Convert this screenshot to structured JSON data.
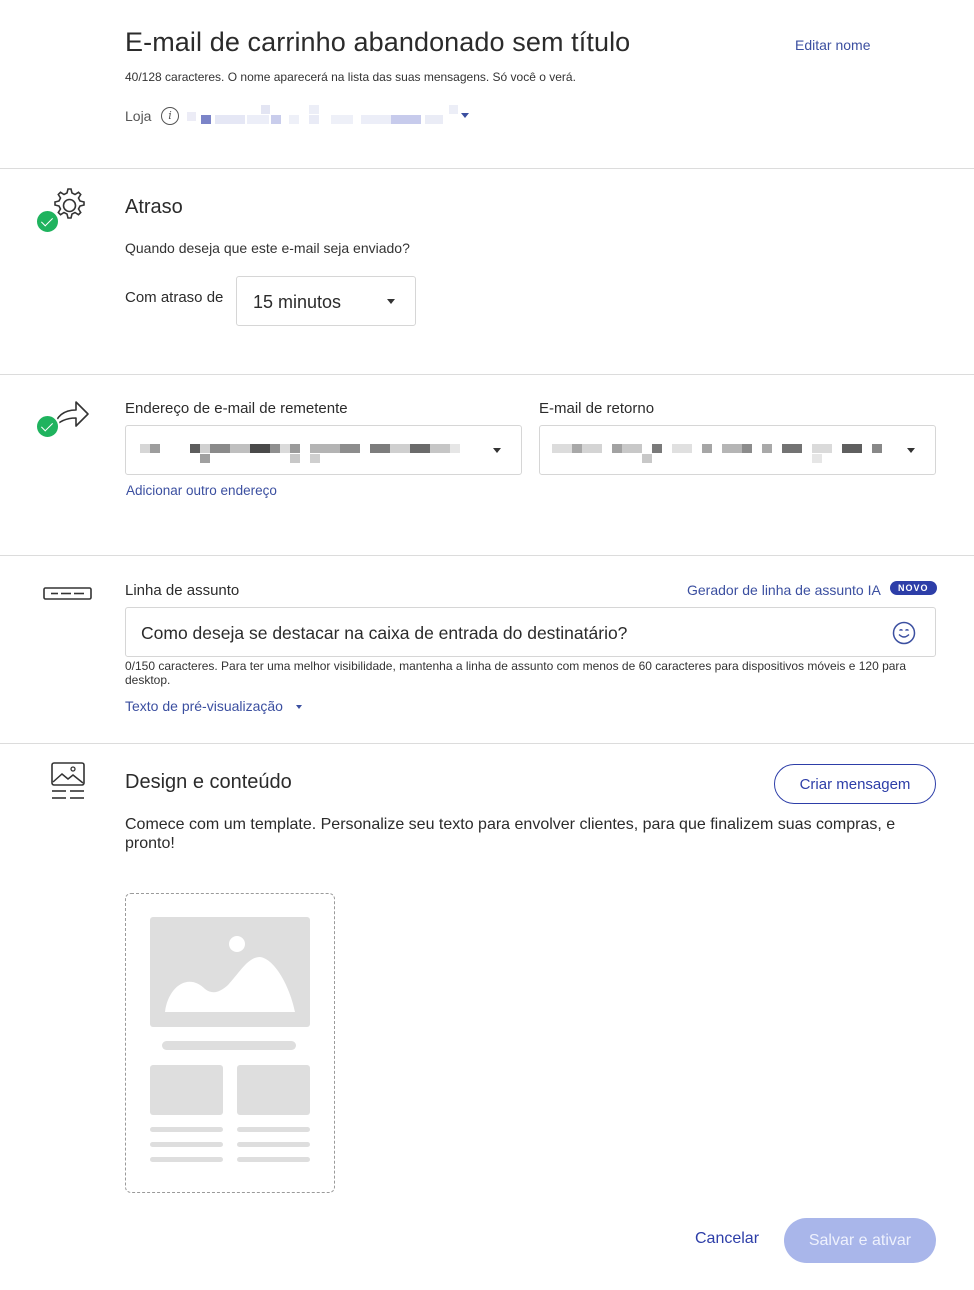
{
  "header": {
    "title": "E-mail de carrinho abandonado sem título",
    "edit_name": "Editar nome",
    "hint": "40/128 caracteres. O nome aparecerá na lista das suas mensagens. Só você o verá.",
    "store_label": "Loja",
    "info_glyph": "i"
  },
  "delay": {
    "title": "Atraso",
    "question": "Quando deseja que este e-mail seja enviado?",
    "label": "Com atraso de",
    "selected": "15 minutos"
  },
  "sender": {
    "from_label": "Endereço de e-mail de remetente",
    "reply_label": "E-mail de retorno",
    "add_address": "Adicionar outro endereço"
  },
  "subject": {
    "label": "Linha de assunto",
    "ai_link": "Gerador de linha de assunto IA",
    "badge": "NOVO",
    "placeholder": "Como deseja se destacar na caixa de entrada do destinatário?",
    "counter": "0/150 caracteres. Para ter uma melhor visibilidade, mantenha a linha de assunto com menos de 60 caracteres para dispositivos móveis e 120 para desktop.",
    "preview_link": "Texto de pré-visualização"
  },
  "design": {
    "title": "Design e conteúdo",
    "create_button": "Criar mensagem",
    "description": "Comece com um template. Personalize seu texto para envolver clientes, para que finalizem suas compras, e pronto!"
  },
  "footer": {
    "cancel": "Cancelar",
    "save": "Salvar e ativar"
  },
  "icons": {
    "settings": "gear-icon",
    "sender": "share-arrow-icon",
    "subject": "subject-line-icon",
    "design": "template-image-icon",
    "status": "check-circle-icon",
    "emoji": "smiley-icon"
  },
  "colors": {
    "accent": "#2d3ea8",
    "link": "#3b4fa0",
    "success": "#1fb35e",
    "disabled_button": "#a9b6ea"
  }
}
